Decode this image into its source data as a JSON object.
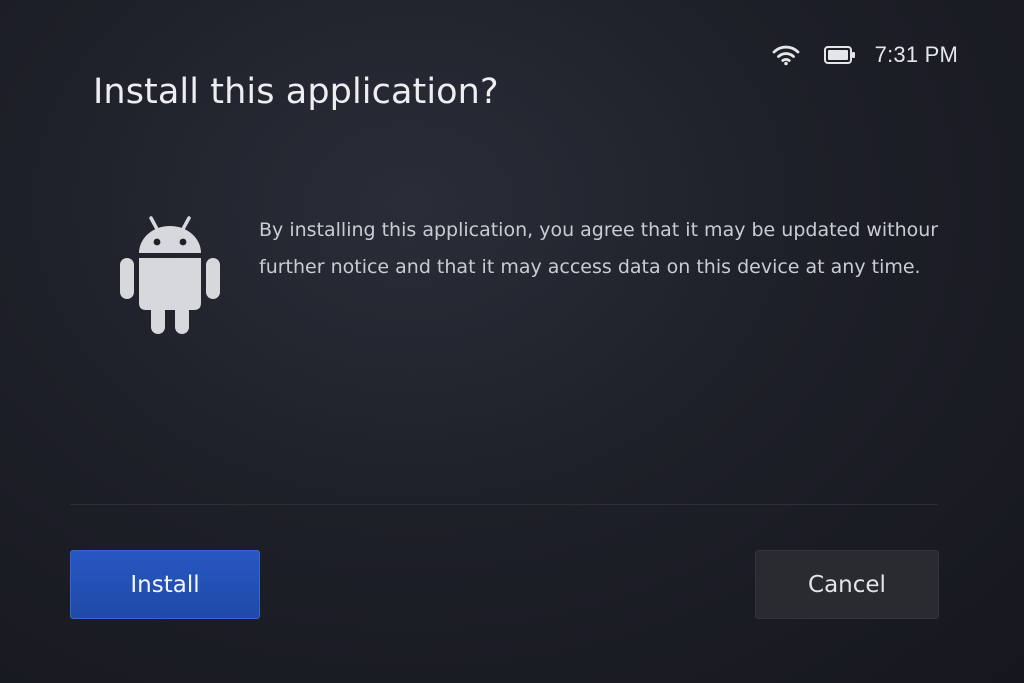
{
  "status_bar": {
    "wifi_icon": "wifi-icon",
    "battery_icon": "battery-icon",
    "time": "7:31 PM"
  },
  "dialog": {
    "title": "Install this application?",
    "app_icon": "android-robot-icon",
    "message": "By installing this application, you agree that it may be updated withour further notice and that it may access data on this device at any time."
  },
  "actions": {
    "install_label": "Install",
    "cancel_label": "Cancel"
  },
  "colors": {
    "background": "#1e2029",
    "primary_button": "#2350b5",
    "secondary_button": "#2a2b31",
    "icon": "#d6d8dc"
  }
}
